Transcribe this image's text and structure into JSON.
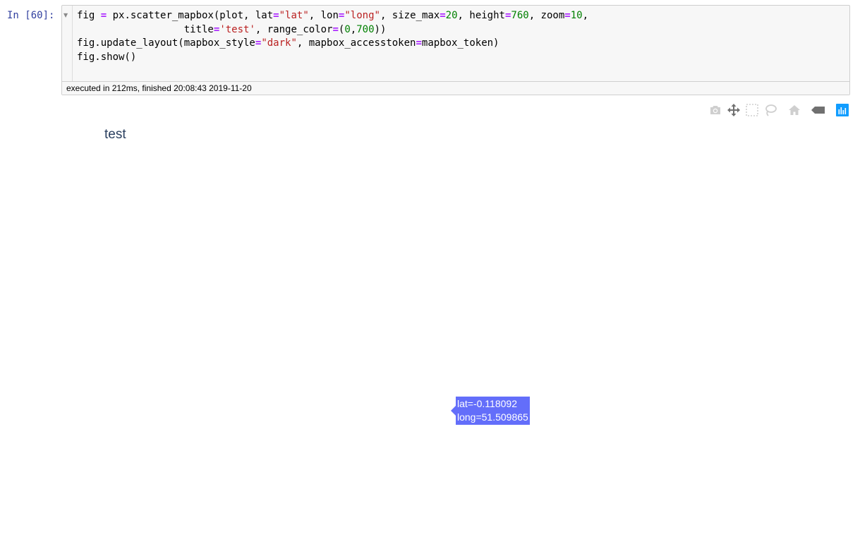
{
  "cell": {
    "prompt": "In [60]:",
    "code_lines": [
      [
        {
          "t": "fig ",
          "c": ""
        },
        {
          "t": "=",
          "c": "op"
        },
        {
          "t": " px.scatter_mapbox(plot, lat",
          "c": ""
        },
        {
          "t": "=",
          "c": "op"
        },
        {
          "t": "\"lat\"",
          "c": "str"
        },
        {
          "t": ", lon",
          "c": ""
        },
        {
          "t": "=",
          "c": "op"
        },
        {
          "t": "\"long\"",
          "c": "str"
        },
        {
          "t": ", size_max",
          "c": ""
        },
        {
          "t": "=",
          "c": "op"
        },
        {
          "t": "20",
          "c": "num"
        },
        {
          "t": ", height",
          "c": ""
        },
        {
          "t": "=",
          "c": "op"
        },
        {
          "t": "760",
          "c": "num"
        },
        {
          "t": ", zoom",
          "c": ""
        },
        {
          "t": "=",
          "c": "op"
        },
        {
          "t": "10",
          "c": "num"
        },
        {
          "t": ",",
          "c": ""
        }
      ],
      [
        {
          "t": "                  title",
          "c": ""
        },
        {
          "t": "=",
          "c": "op"
        },
        {
          "t": "'test'",
          "c": "str"
        },
        {
          "t": ", range_color",
          "c": ""
        },
        {
          "t": "=",
          "c": "op"
        },
        {
          "t": "(",
          "c": ""
        },
        {
          "t": "0",
          "c": "num"
        },
        {
          "t": ",",
          "c": ""
        },
        {
          "t": "700",
          "c": "num"
        },
        {
          "t": "))",
          "c": ""
        }
      ],
      [
        {
          "t": "fig.update_layout(mapbox_style",
          "c": ""
        },
        {
          "t": "=",
          "c": "op"
        },
        {
          "t": "\"dark\"",
          "c": "str"
        },
        {
          "t": ", mapbox_accesstoken",
          "c": ""
        },
        {
          "t": "=",
          "c": "op"
        },
        {
          "t": "mapbox_token)",
          "c": ""
        }
      ],
      [
        {
          "t": "fig.show()",
          "c": ""
        }
      ]
    ],
    "exec_info": "executed in 212ms, finished 20:08:43 2019-11-20"
  },
  "modebar": {
    "buttons": [
      {
        "icon": "camera-icon",
        "color": "#cfcfcf"
      },
      {
        "icon": "pan-icon",
        "color": "#707070"
      },
      {
        "icon": "box-select-icon",
        "color": "#cfcfcf"
      },
      {
        "icon": "lasso-icon",
        "color": "#cfcfcf"
      },
      {
        "icon": "home-icon",
        "color": "#cfcfcf"
      },
      {
        "icon": "hover-closest-icon",
        "color": "#707070"
      },
      {
        "icon": "plotly-logo-icon",
        "color": "#119dff"
      }
    ]
  },
  "plot": {
    "title": "test",
    "hover": {
      "line1": "lat=-0.118092",
      "line2": "long=51.509865",
      "color": "#636efa"
    }
  }
}
